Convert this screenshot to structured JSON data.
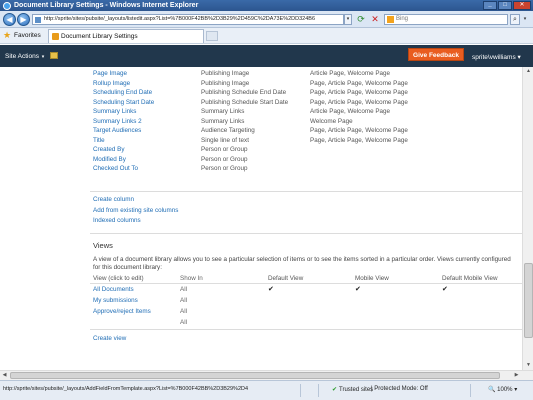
{
  "window": {
    "title": "Document Library Settings - Windows Internet Explorer",
    "min_glyph": "_",
    "max_glyph": "□",
    "close_glyph": "✕"
  },
  "address": {
    "back_glyph": "◀",
    "forward_glyph": "▶",
    "url": "http://sprite/sites/pubsite/_layouts/listedit.aspx?List=%7B000F42BB%2D3B29%2D459C%2DA73E%2DD324B6",
    "search_placeholder": "Bing",
    "refresh_glyph": "⟳",
    "stop_glyph": "✕",
    "go_glyph": "⌕"
  },
  "favorites": {
    "label": "Favorites",
    "tab_title": "Document Library Settings"
  },
  "sharepoint": {
    "site_actions": "Site Actions",
    "feedback": "Give Feedback",
    "user": "sprite\\vwilliams",
    "caret": "▾"
  },
  "columns": [
    {
      "name": "Page Image",
      "type": "Publishing Image",
      "used_in": "Article Page, Welcome Page"
    },
    {
      "name": "Rollup Image",
      "type": "Publishing Image",
      "used_in": "Page, Article Page, Welcome Page"
    },
    {
      "name": "Scheduling End Date",
      "type": "Publishing Schedule End Date",
      "used_in": "Page, Article Page, Welcome Page"
    },
    {
      "name": "Scheduling Start Date",
      "type": "Publishing Schedule Start Date",
      "used_in": "Page, Article Page, Welcome Page"
    },
    {
      "name": "Summary Links",
      "type": "Summary Links",
      "used_in": "Article Page, Welcome Page"
    },
    {
      "name": "Summary Links 2",
      "type": "Summary Links",
      "used_in": "Welcome Page"
    },
    {
      "name": "Target Audiences",
      "type": "Audience Targeting",
      "used_in": "Page, Article Page, Welcome Page"
    },
    {
      "name": "Title",
      "type": "Single line of text",
      "used_in": "Page, Article Page, Welcome Page"
    },
    {
      "name": "Created By",
      "type": "Person or Group",
      "used_in": ""
    },
    {
      "name": "Modified By",
      "type": "Person or Group",
      "used_in": ""
    },
    {
      "name": "Checked Out To",
      "type": "Person or Group",
      "used_in": ""
    }
  ],
  "column_links": {
    "create": "Create column",
    "add_existing": "Add from existing site columns",
    "indexed": "Indexed columns"
  },
  "views": {
    "heading": "Views",
    "description": "A view of a document library allows you to see a particular selection of items or to see the items sorted in a particular order. Views currently configured for this document library:",
    "headers": {
      "name": "View (click to edit)",
      "show_in": "Show In",
      "default": "Default View",
      "mobile": "Mobile View",
      "default_mobile": "Default Mobile View"
    },
    "check_glyph": "✔",
    "rows": [
      {
        "name": "All Documents",
        "show_in": "All",
        "default": true,
        "mobile": true,
        "default_mobile": true
      },
      {
        "name": "My submissions",
        "show_in": "All",
        "default": false,
        "mobile": false,
        "default_mobile": false
      },
      {
        "name": "Approve/reject Items",
        "show_in": "All",
        "default": false,
        "mobile": false,
        "default_mobile": false
      },
      {
        "name": "",
        "show_in": "All",
        "default": false,
        "mobile": false,
        "default_mobile": false
      }
    ],
    "create_view": "Create view"
  },
  "status": {
    "url": "http://sprite/sites/pubsite/_layouts/AddFieldFromTemplate.aspx?List=%7B000F42BB%2D3B29%2D4",
    "trusted": "Trusted sites",
    "protected": "| Protected Mode: Off",
    "zoom": "100%"
  }
}
